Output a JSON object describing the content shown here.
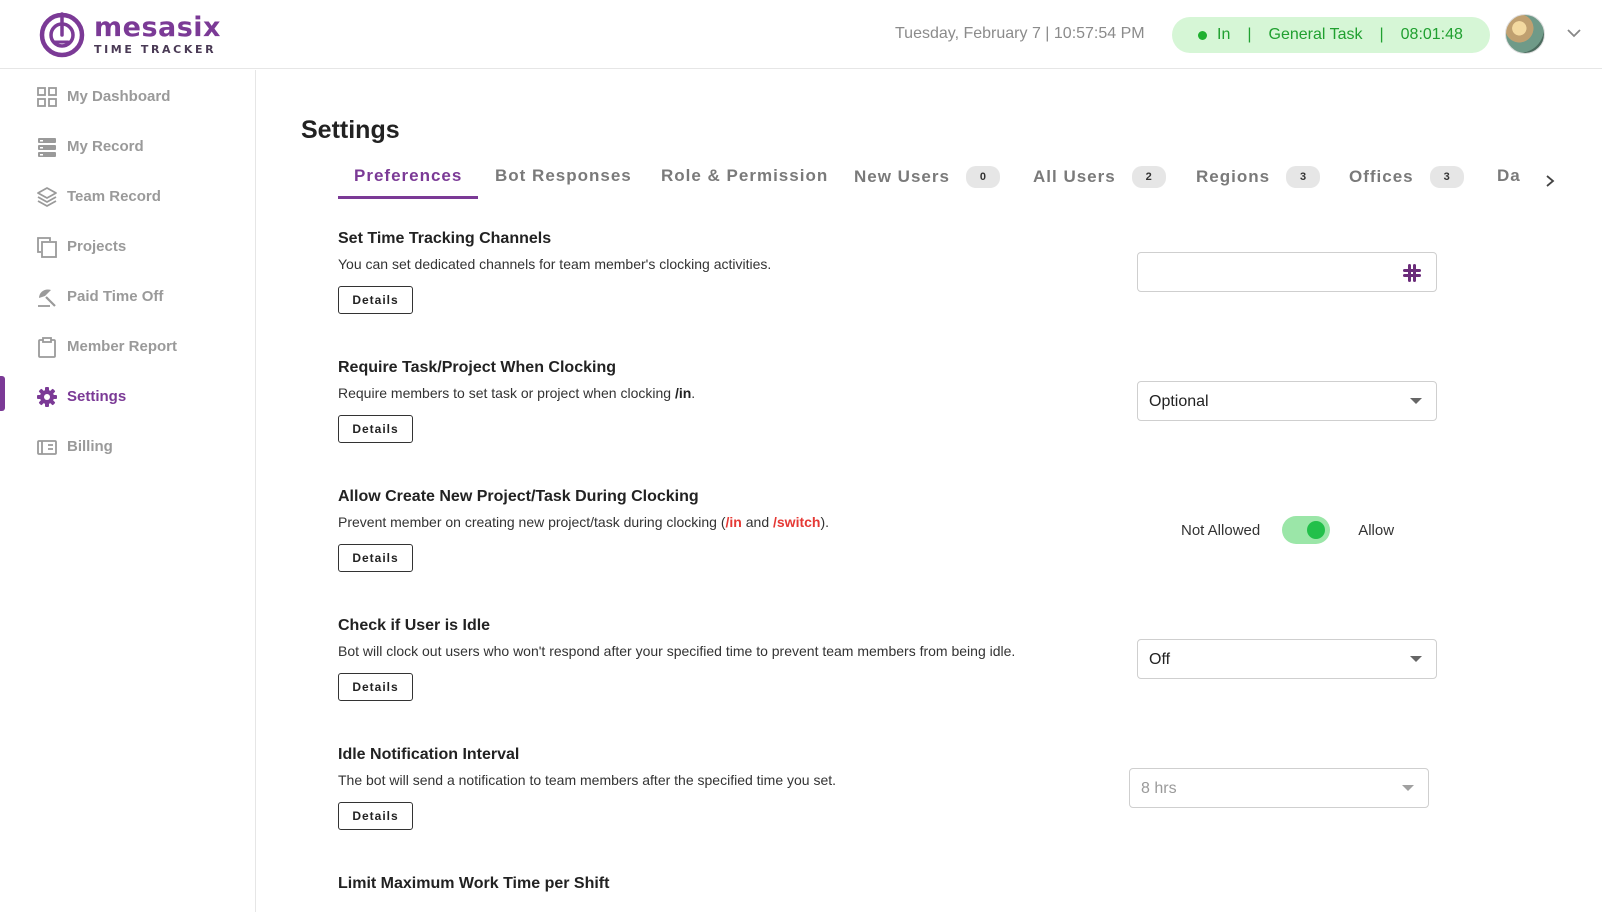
{
  "brand": {
    "name": "mesasix",
    "tagline": "TIME TRACKER",
    "color": "#7b3a96"
  },
  "header": {
    "datetime": "Tuesday, February 7 | 10:57:54 PM",
    "status": {
      "state": "In",
      "task": "General Task",
      "timer": "08:01:48",
      "sep": "|",
      "color": "#20a030"
    }
  },
  "sidebar": {
    "items": [
      {
        "label": "My Dashboard",
        "icon": "grid-icon"
      },
      {
        "label": "My Record",
        "icon": "server-icon"
      },
      {
        "label": "Team Record",
        "icon": "layers-icon"
      },
      {
        "label": "Projects",
        "icon": "copy-icon"
      },
      {
        "label": "Paid Time Off",
        "icon": "beach-umbrella-icon"
      },
      {
        "label": "Member Report",
        "icon": "clipboard-icon"
      },
      {
        "label": "Settings",
        "icon": "gear-icon",
        "active": true
      },
      {
        "label": "Billing",
        "icon": "billing-icon"
      }
    ]
  },
  "page": {
    "title": "Settings"
  },
  "tabs": [
    {
      "label": "Preferences",
      "active": true
    },
    {
      "label": "Bot Responses"
    },
    {
      "label": "Role & Permission"
    },
    {
      "label": "New Users",
      "count": "0"
    },
    {
      "label": "All Users",
      "count": "2"
    },
    {
      "label": "Regions",
      "count": "3"
    },
    {
      "label": "Offices",
      "count": "3"
    },
    {
      "label": "Da"
    }
  ],
  "settings": {
    "details_label": "Details",
    "channels": {
      "title": "Set Time Tracking Channels",
      "desc": "You can set dedicated channels for team member's clocking activities.",
      "value": ""
    },
    "require_task": {
      "title": "Require Task/Project When Clocking",
      "desc_pre": "Require members to set task or project when clocking ",
      "desc_cmd": "/in",
      "desc_post": ".",
      "value": "Optional"
    },
    "allow_create": {
      "title": "Allow Create New Project/Task During Clocking",
      "desc_pre": "Prevent member on creating new project/task during clocking (",
      "cmd1": "/in",
      "mid": " and ",
      "cmd2": "/switch",
      "desc_post": ").",
      "off_label": "Not Allowed",
      "on_label": "Allow",
      "enabled": true
    },
    "idle": {
      "title": "Check if User is Idle",
      "desc": "Bot will clock out users who won't respond after your specified time to prevent team members from being idle.",
      "value": "Off"
    },
    "idle_interval": {
      "title": "Idle Notification Interval",
      "desc": "The bot will send a notification to team members after the specified time you set.",
      "value": "8 hrs",
      "disabled": true
    },
    "max_work": {
      "title": "Limit Maximum Work Time per Shift"
    }
  }
}
